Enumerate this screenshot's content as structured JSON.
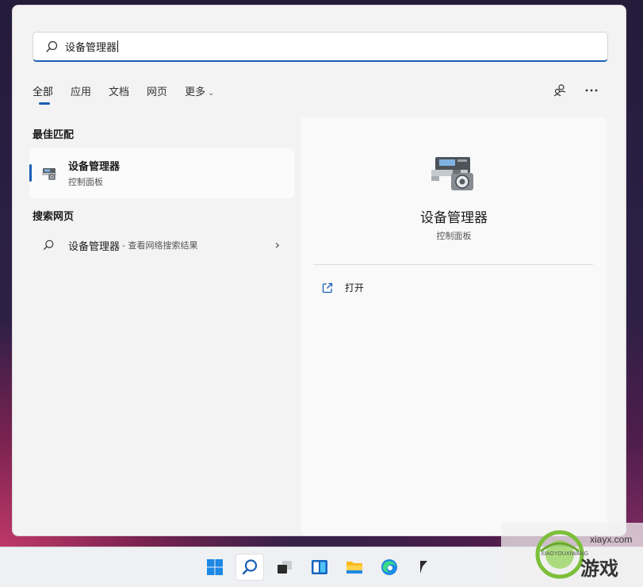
{
  "search": {
    "value": "设备管理器"
  },
  "tabs": [
    {
      "label": "全部"
    },
    {
      "label": "应用"
    },
    {
      "label": "文档"
    },
    {
      "label": "网页"
    },
    {
      "label": "更多"
    }
  ],
  "sections": {
    "best_match": "最佳匹配",
    "web": "搜索网页"
  },
  "best_match": {
    "name": "设备管理器",
    "subtitle": "控制面板"
  },
  "web_result": {
    "query": "设备管理器",
    "suffix": "- 查看网络搜索结果"
  },
  "detail": {
    "title": "设备管理器",
    "subtitle": "控制面板",
    "open_label": "打开"
  },
  "watermark": {
    "url": "xiayx.com",
    "site_pinyin": "XIAOYOUXIWANG",
    "text": "游戏"
  },
  "colors": {
    "accent": "#1a5fb4",
    "panel_bg": "#f3f3f3"
  }
}
